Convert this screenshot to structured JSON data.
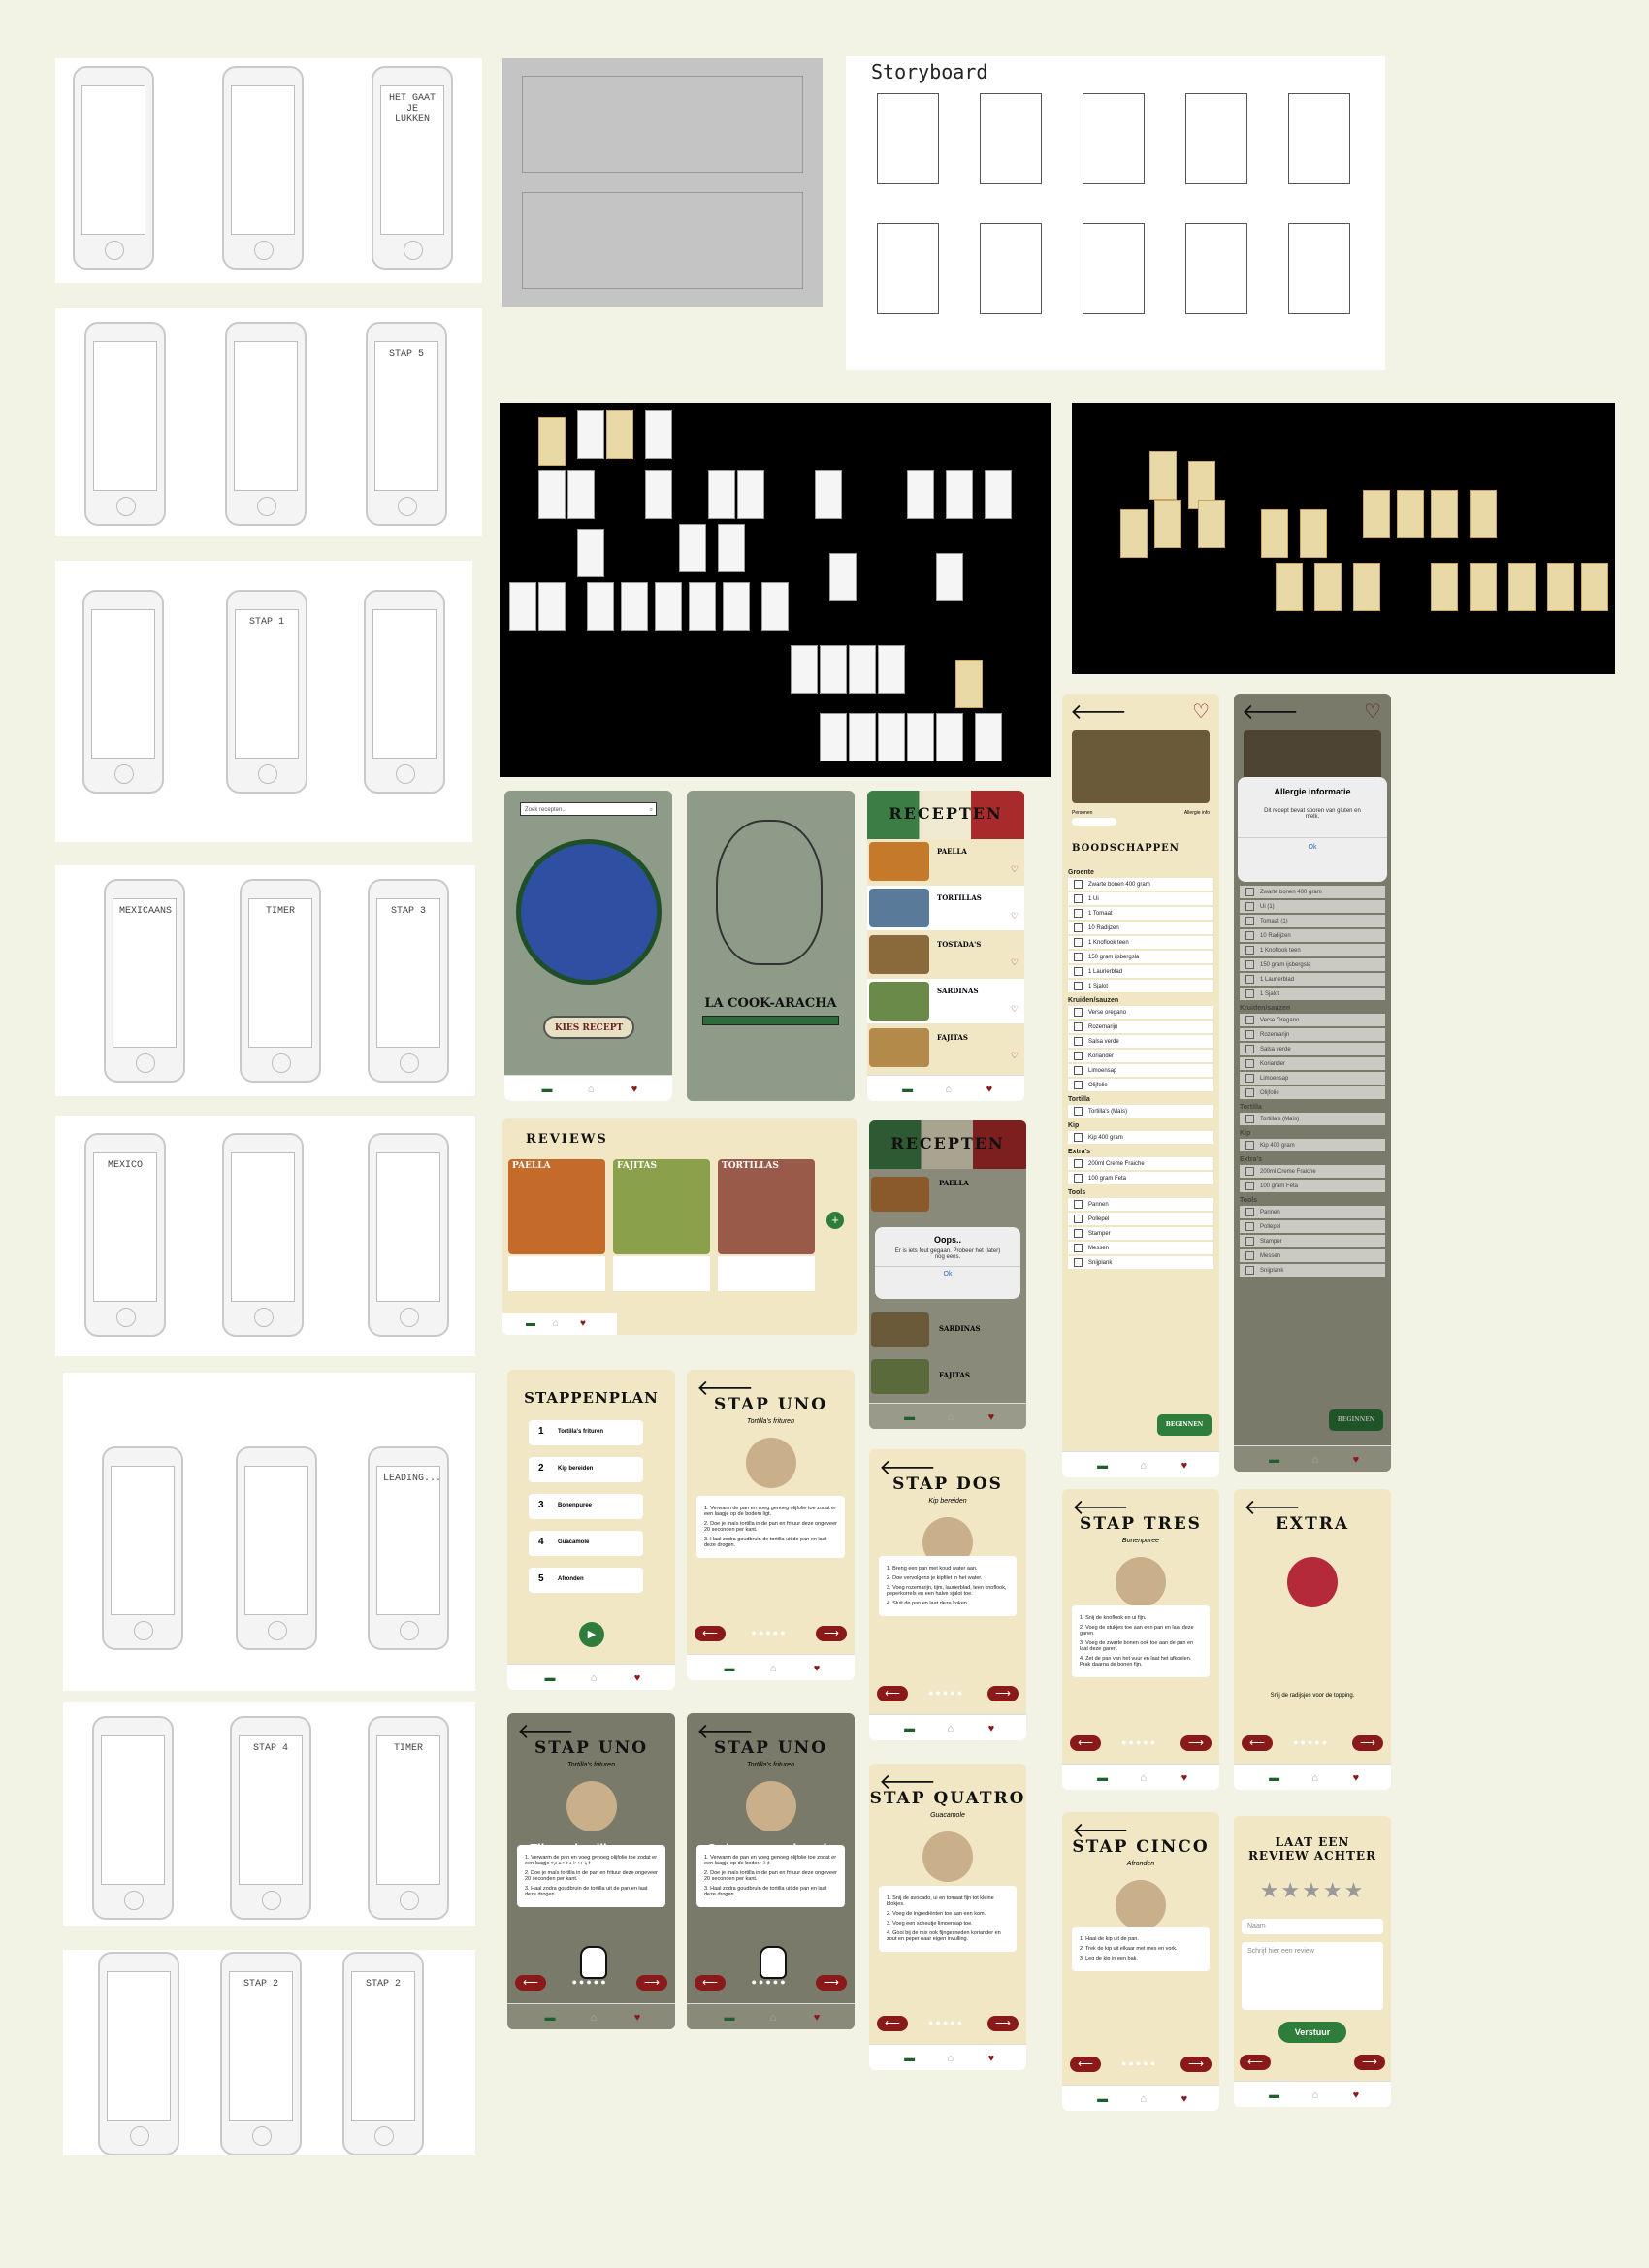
{
  "storyboard": {
    "title": "Storyboard"
  },
  "sketch_labels": {
    "s3_title": "HET GAAT JE LUKKEN",
    "s6_title": "STAP 5",
    "s9_title": "STAP 1",
    "s10_title": "MEXICAANS",
    "s11_title": "TIMER",
    "s12_title": "STAP 3",
    "s13_title": "MEXICO",
    "s16_title": "LEADING...",
    "s17_title": "STAP 4",
    "s18_title": "TIMER",
    "s20_title": "STAP 2",
    "s21_title": "STAP 2"
  },
  "home": {
    "search_placeholder": "Zoek recepten...",
    "button": "KIES RECEPT"
  },
  "loading": {
    "title": "LA COOK-ARACHA"
  },
  "recipes_list": {
    "title": "RECEPTEN",
    "items": [
      {
        "name": "PAELLA"
      },
      {
        "name": "TORTILLAS"
      },
      {
        "name": "TOSTADA'S"
      },
      {
        "name": "SARDINAS"
      },
      {
        "name": "FAJITAS"
      }
    ]
  },
  "recipes_error": {
    "title": "RECEPTEN",
    "item_1": "PAELLA",
    "item_2": "SARDINAS",
    "item_3": "FAJITAS",
    "modal_title": "Oops..",
    "modal_text": "Er is iets fout gegaan. Probeer het (later) nog eens.",
    "modal_ok": "Ok"
  },
  "reviews": {
    "title": "REVIEWS",
    "cards": [
      {
        "name": "PAELLA"
      },
      {
        "name": "FAJITAS"
      },
      {
        "name": "TORTILLAS"
      }
    ],
    "add_label": "+"
  },
  "ingredients": {
    "labels": {
      "personen": "Personen",
      "allergie": "Allergie info"
    },
    "title": "BOODSCHAPPEN",
    "sections": [
      {
        "title": "Groente",
        "items": [
          "Zwarte bonen 400 gram",
          "1 Ui",
          "1 Tomaat",
          "10 Radijzen",
          "1 Knoflook teen",
          "150 gram ijsbergsla",
          "1 Laurierblad",
          "1 Sjalot"
        ]
      },
      {
        "title": "Kruiden/sauzen",
        "items": [
          "Verse oregano",
          "Rozemarijn",
          "Salsa verde",
          "Koriander",
          "Limoensap",
          "Olijfolie"
        ]
      },
      {
        "title": "Tortilla",
        "items": [
          "Tortilla's (Maïs)"
        ]
      },
      {
        "title": "Kip",
        "items": [
          "Kip 400 gram"
        ]
      },
      {
        "title": "Extra's",
        "items": [
          "200ml Creme Fraiche",
          "100 gram Feta"
        ]
      },
      {
        "title": "Tools",
        "items": [
          "Pannen",
          "Pollepel",
          "Stamper",
          "Messen",
          "Snijplank"
        ]
      }
    ],
    "button": "BEGINNEN"
  },
  "allergy": {
    "modal_title": "Allergie informatie",
    "modal_text": "Dit recept bevat sporen van gluten en melk.",
    "modal_ok": "Ok",
    "sections": [
      {
        "title": "",
        "items": [
          "Zwarte bonen 400 gram",
          "Ui (1)",
          "Tomaat (1)",
          "10 Radijzen",
          "1 Knoflook teen",
          "150 gram ijsbergsla",
          "1 Laurierblad",
          "1 Sjalot"
        ]
      },
      {
        "title": "Kruiden/sauzen",
        "items": [
          "Verse Oregano",
          "Rozemarijn",
          "Salsa verde",
          "Koriander",
          "Limoensap",
          "Olijfolie"
        ]
      },
      {
        "title": "Tortilla",
        "items": [
          "Tortilla's (Maïs)"
        ]
      },
      {
        "title": "Kip",
        "items": [
          "Kip 400 gram"
        ]
      },
      {
        "title": "Extra's",
        "items": [
          "200ml Creme Fraiche",
          "100 gram Feta"
        ]
      },
      {
        "title": "Tools",
        "items": [
          "Pannen",
          "Pollepel",
          "Stamper",
          "Messen",
          "Snijplank"
        ]
      }
    ],
    "button": "BEGINNEN"
  },
  "plan": {
    "title": "STAPPENPLAN",
    "steps": [
      {
        "num": "1",
        "label": "Tortilla's frituren"
      },
      {
        "num": "2",
        "label": "Kip bereiden"
      },
      {
        "num": "3",
        "label": "Bonenpuree"
      },
      {
        "num": "4",
        "label": "Guacamole"
      },
      {
        "num": "5",
        "label": "Afronden"
      }
    ]
  },
  "step1": {
    "title": "STAP UNO",
    "subtitle": "Tortilla's frituren",
    "lines": [
      "1. Verwarm de pan en voeg genoeg olijfolie toe zodat er een laagje op de bodem ligt.",
      "2. Doe je maïs tortilla in de pan en frituur deze ongeveer 20 seconden per kant.",
      "3. Haal zodra goudbruin de tortilla uit de pan en laat deze drogen."
    ]
  },
  "step2": {
    "title": "STAP DOS",
    "subtitle": "Kip bereiden",
    "lines": [
      "1. Breng een pan met koud water aan.",
      "2. Doe vervolgens je kipfilet in het water.",
      "3. Voeg rozemarijn, tijm, laurierblad, teen knoflook, peperkorrels en een halve sjalot toe.",
      "4. Sluit de pan en laat deze koken."
    ]
  },
  "step3": {
    "title": "STAP TRES",
    "subtitle": "Bonenpuree",
    "lines": [
      "1. Snij de knoflook en ui fijn.",
      "2. Voeg de stukjes toe aan een pan en laat deze garen.",
      "3. Voeg de zwarte bonen ook toe aan de pan en laat deze garen.",
      "4. Zet de pan van het vuur en laat het afkoelen. Prak daarna de bonen fijn."
    ]
  },
  "extra": {
    "title": "EXTRA",
    "text": "Snij de radijsjes voor de topping."
  },
  "overlay1": {
    "title": "STAP UNO",
    "subtitle": "Tortilla's frituren",
    "hint": "Tik op de pijlen voor volgende stap",
    "lines": [
      "1. Verwarm de pan en voeg genoeg olijfolie toe zodat er een laagje op de bodem ligt.",
      "2. Doe je maïs tortilla in de pan en frituur deze ongeveer 20 seconden per kant.",
      "3. Haal zodra goudbruin de tortilla uit de pan en laat deze drogen."
    ]
  },
  "overlay2": {
    "title": "STAP UNO",
    "subtitle": "Tortilla's frituren",
    "hint": "Swipe voor volgende stap",
    "lines": [
      "1. Verwarm de pan en voeg genoeg olijfolie toe zodat er een laagje op de bodem ligt.",
      "2. Doe je maïs tortilla in de pan en frituur deze ongeveer 20 seconden per kant.",
      "3. Haal zodra goudbruin de tortilla uit de pan en laat deze drogen."
    ]
  },
  "step4": {
    "title": "STAP QUATRO",
    "subtitle": "Guacamole",
    "lines": [
      "1. Snij de avocado, ui en tomaat fijn tot kleine blokjes.",
      "2. Voeg de ingrediënten toe aan een kom.",
      "3. Voeg een scheutje limoensap toe.",
      "4. Gooi bij de mix ook fijngesneden koriander en zout en peper naar eigen invulling."
    ]
  },
  "step5": {
    "title": "STAP CINCO",
    "subtitle": "Afronden",
    "lines": [
      "1. Haal de kip uit de pan.",
      "2. Trek de kip uit elkaar met mes en vork.",
      "3. Leg de kip in een bak."
    ]
  },
  "review_form": {
    "title": "LAAT EEN REVIEW ACHTER",
    "stars": "★★★★★",
    "name_placeholder": "Naam",
    "review_placeholder": "Schrijf hier een review",
    "submit": "Verstuur"
  },
  "arrows": {
    "left": "⟵",
    "right": "⟶"
  },
  "dots": {
    "progress": "●●●●●"
  },
  "icons": {
    "heart": "♥",
    "heart_outline": "♡",
    "home": "⌂",
    "chat": "▬",
    "play": "▶",
    "back": "🡐"
  },
  "colors": {
    "cream": "#f1e7c4",
    "sage": "#8e9b88",
    "red": "#8a1a1a",
    "green": "#2e7d3a",
    "accent_orange": "#e5a93b"
  }
}
